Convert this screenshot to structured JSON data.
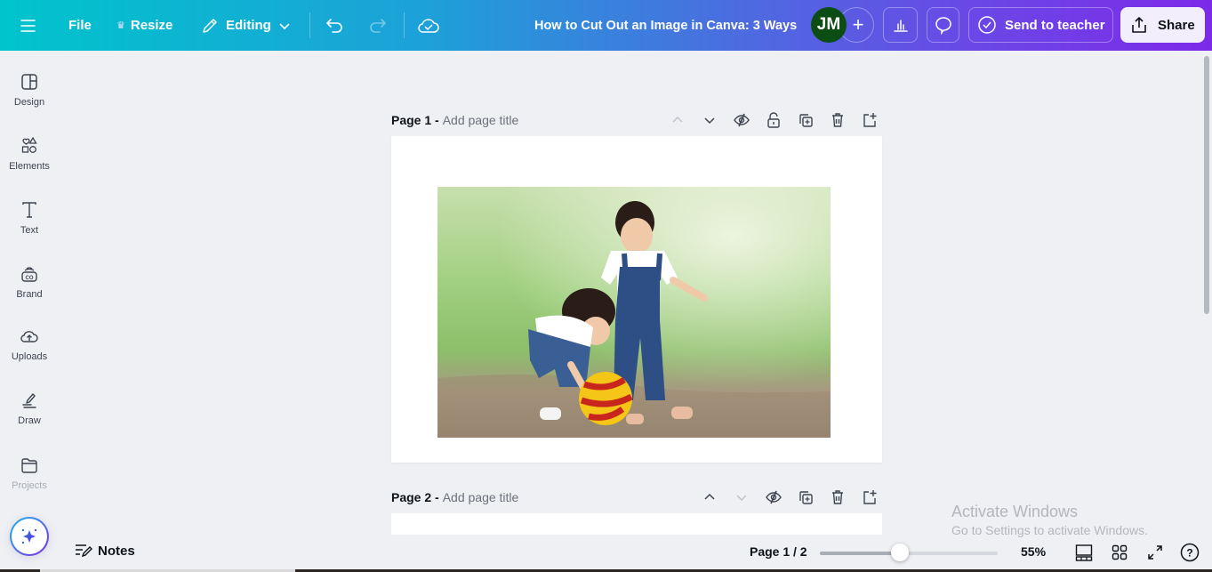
{
  "topbar": {
    "menu_icon": "hamburger-menu-icon",
    "file_label": "File",
    "resize_label": "Resize",
    "editing_label": "Editing",
    "document_title": "How to Cut Out an Image in Canva: 3 Ways",
    "avatar_initials": "JM",
    "avatar_color": "#0b4d12",
    "add_collaborator_symbol": "+",
    "send_to_teacher_label": "Send to teacher",
    "share_label": "Share"
  },
  "sidebar": {
    "items": [
      {
        "label": "Design",
        "icon": "design-icon"
      },
      {
        "label": "Elements",
        "icon": "elements-icon"
      },
      {
        "label": "Text",
        "icon": "text-icon"
      },
      {
        "label": "Brand",
        "icon": "brand-icon"
      },
      {
        "label": "Uploads",
        "icon": "uploads-icon"
      },
      {
        "label": "Draw",
        "icon": "draw-icon"
      },
      {
        "label": "Projects",
        "icon": "projects-icon"
      }
    ],
    "magic_button_icon": "sparkle-icon"
  },
  "pages": [
    {
      "label": "Page 1 -",
      "title_placeholder": "Add page title",
      "image_description": "Two young children in denim overalls playing with a red and yellow ball on grass"
    },
    {
      "label": "Page 2 -",
      "title_placeholder": "Add page title"
    }
  ],
  "bottombar": {
    "notes_label": "Notes",
    "page_indicator": "Page 1 / 2",
    "zoom_percent_label": "55%",
    "zoom_slider_fraction": 0.45
  },
  "watermark": {
    "line1": "Activate Windows",
    "line2": "Go to Settings to activate Windows."
  },
  "colors": {
    "gradient_start": "#00c4cc",
    "gradient_end": "#7d2ae8",
    "canvas_bg": "#eff0f4"
  }
}
